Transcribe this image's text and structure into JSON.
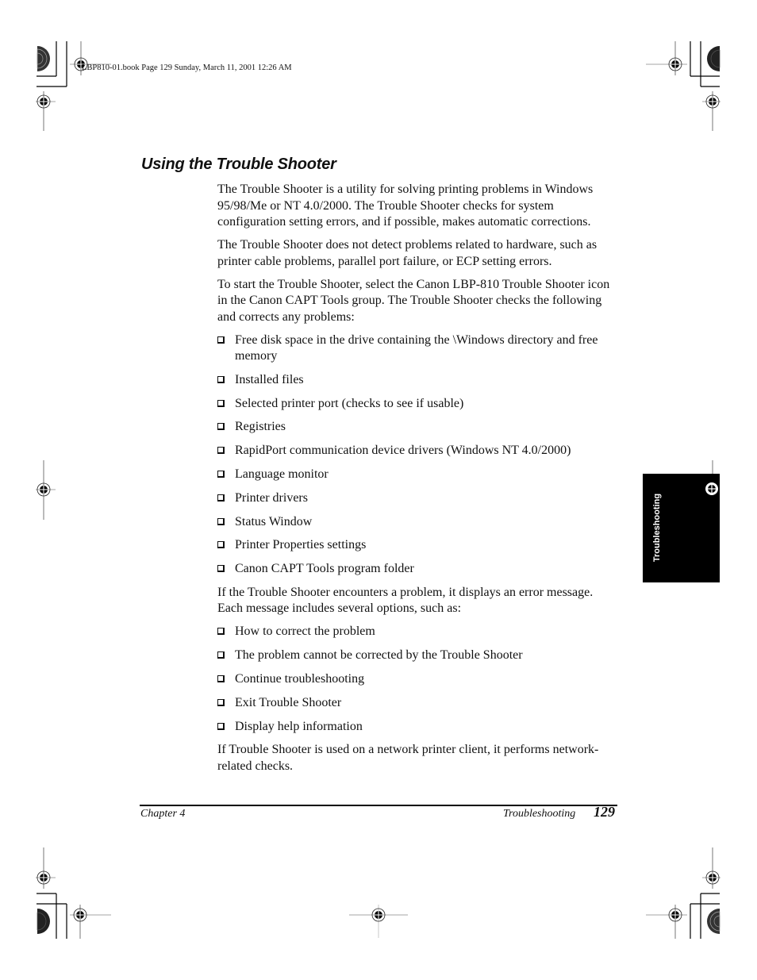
{
  "slug": "LBP810-01.book  Page 129  Sunday, March 11, 2001  12:26 AM",
  "section": {
    "title": "Using the Trouble Shooter",
    "intro_paragraphs": [
      "The Trouble Shooter is a utility for solving printing problems in Windows 95/98/Me or NT 4.0/2000. The Trouble Shooter checks for system configuration setting errors, and if possible, makes automatic corrections.",
      "The Trouble Shooter does not detect problems related to hardware, such as printer cable problems, parallel port failure, or ECP setting errors.",
      "To start the Trouble Shooter, select the Canon LBP-810 Trouble Shooter icon in the Canon CAPT Tools group. The Trouble Shooter checks the following and corrects any problems:"
    ],
    "checks": [
      "Free disk space in the drive containing the \\Windows directory and free memory",
      "Installed files",
      "Selected printer port (checks to see if usable)",
      "Registries",
      "RapidPort communication device drivers (Windows NT 4.0/2000)",
      "Language monitor",
      "Printer drivers",
      "Status Window",
      "Printer Properties settings",
      "Canon CAPT Tools program folder"
    ],
    "error_paragraph": "If the Trouble Shooter encounters a problem, it displays an error message. Each message includes several options, such as:",
    "options": [
      "How to correct the problem",
      "The problem cannot be corrected by the Trouble Shooter",
      "Continue troubleshooting",
      "Exit Trouble Shooter",
      "Display help information"
    ],
    "closing_paragraph": "If Trouble Shooter is used on a network printer client, it performs network-related checks."
  },
  "footer": {
    "chapter": "Chapter 4",
    "section": "Troubleshooting",
    "page_number": "129"
  },
  "side_tab": {
    "label": "Troubleshooting"
  }
}
